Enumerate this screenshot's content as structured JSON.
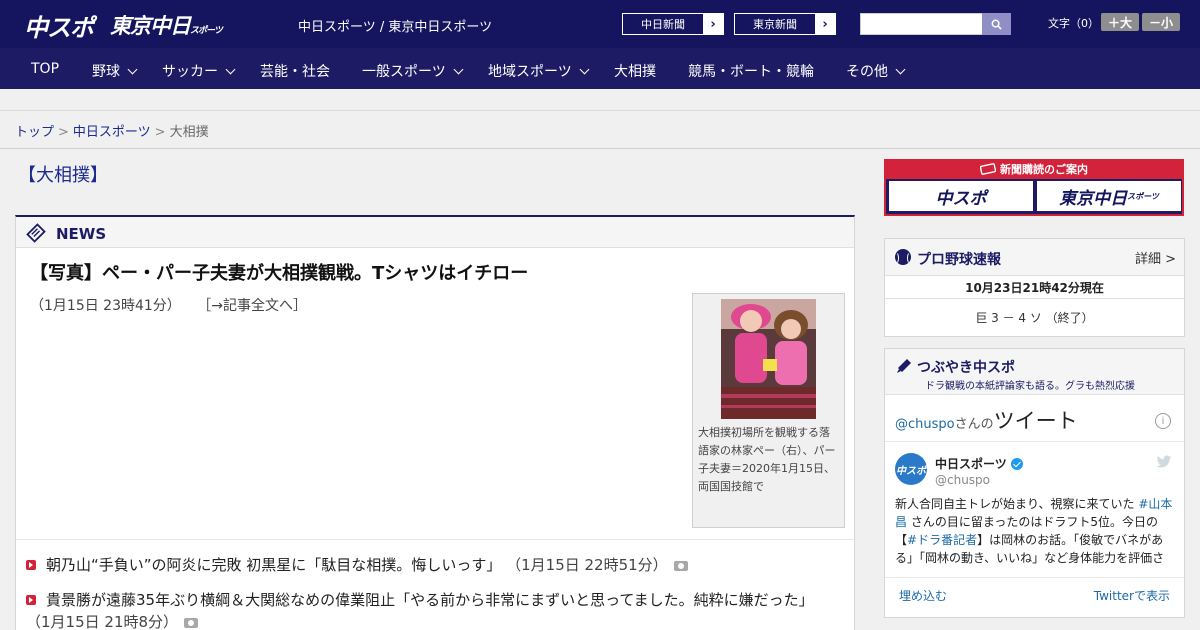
{
  "header": {
    "logo_chuspo": "中スポ",
    "logo_tokyo": "東京中日",
    "logo_tokyo_small": "スポーツ",
    "site_name": "中日スポーツ / 東京中日スポーツ",
    "paper_links": [
      "中日新聞",
      "東京新聞"
    ],
    "search_placeholder": "",
    "font_label": "文字（0）",
    "font_bigger": "＋大",
    "font_smaller": "－小"
  },
  "nav": {
    "items": [
      {
        "label": "TOP",
        "dropdown": false
      },
      {
        "label": "野球",
        "dropdown": true
      },
      {
        "label": "サッカー",
        "dropdown": true
      },
      {
        "label": "芸能・社会",
        "dropdown": false
      },
      {
        "label": "一般スポーツ",
        "dropdown": true
      },
      {
        "label": "地域スポーツ",
        "dropdown": true
      },
      {
        "label": "大相撲",
        "dropdown": false
      },
      {
        "label": "競馬・ボート・競輪",
        "dropdown": false
      },
      {
        "label": "その他",
        "dropdown": true
      }
    ]
  },
  "breadcrumb": {
    "items": [
      "トップ",
      "中日スポーツ",
      "大相撲"
    ],
    "separator": ">"
  },
  "page": {
    "title": "【大相撲】"
  },
  "news": {
    "section_label": "NEWS",
    "headline": "【写真】ペー・パー子夫妻が大相撲観戦。Tシャツはイチロー",
    "meta_date": "（1月15日 23時41分）",
    "meta_link": "［→記事全文へ］",
    "photo_caption": "大相撲初場所を観戦する落語家の林家ペー（右）、パー子夫妻＝2020年1月15日、両国国技館で",
    "list": [
      {
        "title": "朝乃山“手負い”の阿炎に完敗 初黒星に「駄目な相撲。悔しいっす」",
        "date": "（1月15日 22時51分）"
      },
      {
        "title": "貴景勝が遠藤35年ぶり横綱＆大関総なめの偉業阻止「やる前から非常にまずいと思ってました。純粋に嫌だった」",
        "date": "（1月15日 21時8分）"
      }
    ]
  },
  "sidebar": {
    "subscription": {
      "banner": "新聞購読のご案内",
      "chuspo": "中スポ",
      "tokyo": "東京中日",
      "tokyo_small": "スポーツ"
    },
    "baseball": {
      "title": "プロ野球速報",
      "more": "詳細 >",
      "updated": "10月23日21時42分現在",
      "score": "巨 3 － 4 ソ （終了）"
    },
    "tweets": {
      "title": "つぶやき中スポ",
      "subtitle": "ドラ観戦の本紙評論家も語る。グラも熱烈応援",
      "handle_link": "@chuspo",
      "handle_suffix": "さんの",
      "heading": "ツイート",
      "info": "i",
      "account_name": "中日スポーツ",
      "account_handle": "@chuspo",
      "avatar_text": "中スポ",
      "tweet_parts": [
        {
          "text": "新人合同自主トレが始まり、視察に来ていた ",
          "tag": false
        },
        {
          "text": "#山本昌",
          "tag": true
        },
        {
          "text": " さんの目に留まったのはドラフト5位。今日の【",
          "tag": false
        },
        {
          "text": "#ドラ番記者",
          "tag": true
        },
        {
          "text": "】は岡林のお話。「俊敏でバネがある」「岡林の動き、いいね」など身体能力を評価された",
          "tag": false
        }
      ],
      "embed": "埋め込む",
      "view_on": "Twitterで表示"
    }
  }
}
